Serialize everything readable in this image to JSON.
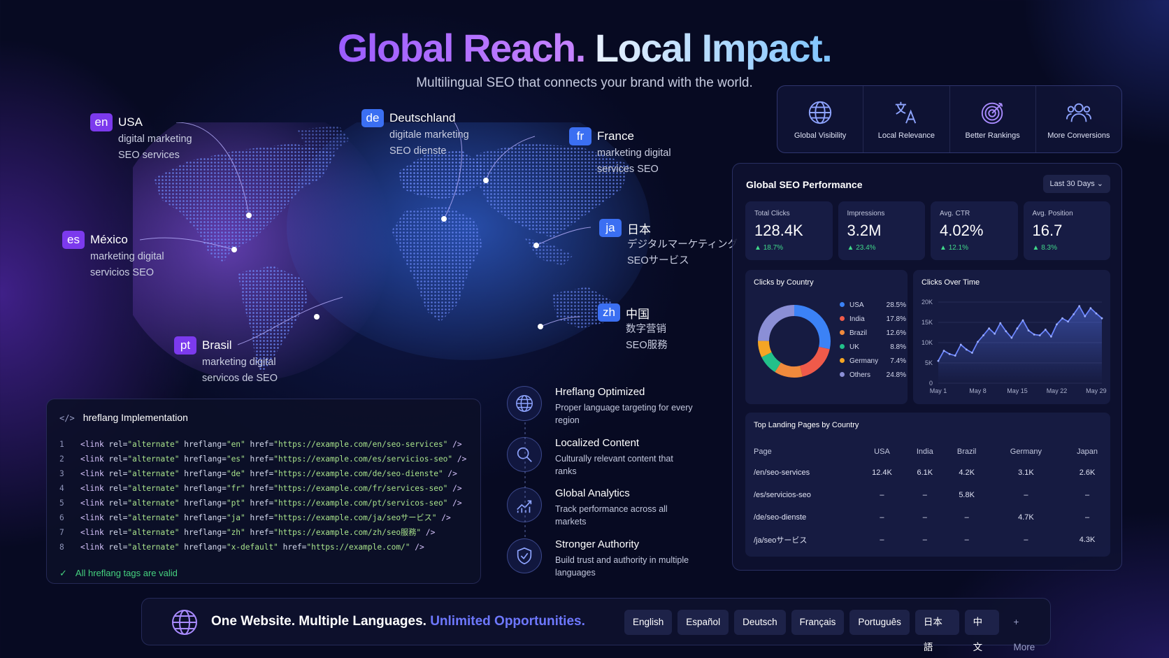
{
  "header": {
    "title_part1": "Global Reach.",
    "title_part2": "Local Impact.",
    "subtitle": "Multilingual SEO that connects your brand with the world."
  },
  "locations": [
    {
      "code": "en",
      "name": "USA",
      "keywords": [
        "digital marketing",
        "SEO services"
      ]
    },
    {
      "code": "de",
      "name": "Deutschland",
      "keywords": [
        "digitale marketing",
        "SEO dienste"
      ]
    },
    {
      "code": "fr",
      "name": "France",
      "keywords": [
        "marketing digital",
        "services SEO"
      ]
    },
    {
      "code": "es",
      "name": "México",
      "keywords": [
        "marketing digital",
        "servicios SEO"
      ]
    },
    {
      "code": "ja",
      "name": "日本",
      "keywords": [
        "デジタルマーケティング",
        "SEOサービス"
      ]
    },
    {
      "code": "zh",
      "name": "中国",
      "keywords": [
        "数字营销",
        "SEO服務"
      ]
    },
    {
      "code": "pt",
      "name": "Brasil",
      "keywords": [
        "marketing digital",
        "servicos de SEO"
      ]
    }
  ],
  "features": [
    {
      "label": "Global Visibility",
      "icon": "globe-icon"
    },
    {
      "label": "Local Relevance",
      "icon": "translate-icon"
    },
    {
      "label": "Better Rankings",
      "icon": "target-icon"
    },
    {
      "label": "More Conversions",
      "icon": "users-icon"
    }
  ],
  "dashboard": {
    "title": "Global SEO Performance",
    "range": "Last 30 Days",
    "kpis": [
      {
        "label": "Total Clicks",
        "value": "128.4K",
        "delta": "18.7%"
      },
      {
        "label": "Impressions",
        "value": "3.2M",
        "delta": "23.4%"
      },
      {
        "label": "Avg. CTR",
        "value": "4.02%",
        "delta": "12.1%"
      },
      {
        "label": "Avg. Position",
        "value": "16.7",
        "delta": "8.3%"
      }
    ],
    "country_title": "Clicks by Country",
    "time_title": "Clicks Over Time",
    "table_title": "Top Landing Pages by Country",
    "table": {
      "headers": [
        "Page",
        "USA",
        "India",
        "Brazil",
        "Germany",
        "Japan"
      ],
      "rows": [
        [
          "/en/seo-services",
          "12.4K",
          "6.1K",
          "4.2K",
          "3.1K",
          "2.6K"
        ],
        [
          "/es/servicios-seo",
          "–",
          "–",
          "5.8K",
          "–",
          "–"
        ],
        [
          "/de/seo-dienste",
          "–",
          "–",
          "–",
          "4.7K",
          "–"
        ],
        [
          "/ja/seoサービス",
          "–",
          "–",
          "–",
          "–",
          "4.3K"
        ]
      ]
    }
  },
  "chart_data": [
    {
      "type": "pie",
      "title": "Clicks by Country",
      "categories": [
        "USA",
        "India",
        "Brazil",
        "UK",
        "Germany",
        "Others"
      ],
      "values": [
        28.5,
        17.8,
        12.6,
        8.8,
        7.4,
        24.8
      ],
      "labels": [
        "28.5%",
        "17.8%",
        "12.6%",
        "8.8%",
        "7.4%",
        "24.8%"
      ],
      "colors": [
        "#3b82f6",
        "#ef5a4a",
        "#f08a3c",
        "#22c08a",
        "#f5a524",
        "#8b8fd6"
      ],
      "donut": true
    },
    {
      "type": "line",
      "title": "Clicks Over Time",
      "x_ticks": [
        "May 1",
        "May 8",
        "May 15",
        "May 22",
        "May 29"
      ],
      "y_ticks": [
        "20K",
        "15K",
        "10K",
        "5K",
        "0"
      ],
      "ylim": [
        0,
        20000
      ],
      "x": [
        1,
        2,
        3,
        4,
        5,
        6,
        7,
        8,
        9,
        10,
        11,
        12,
        13,
        14,
        15,
        16,
        17,
        18,
        19,
        20,
        21,
        22,
        23,
        24,
        25,
        26,
        27,
        28,
        29,
        30
      ],
      "values": [
        5500,
        8000,
        7200,
        6800,
        9500,
        8300,
        7500,
        10200,
        11800,
        13500,
        12200,
        14800,
        12800,
        11200,
        13500,
        15500,
        13000,
        12000,
        11800,
        13200,
        11500,
        14500,
        16000,
        15200,
        17000,
        19000,
        16500,
        18500,
        17200,
        16000
      ]
    }
  ],
  "hreflang": {
    "title": "hreflang Implementation",
    "icon": "code-icon",
    "lines": [
      {
        "n": "1",
        "tag": "<link",
        "rel": " rel=",
        "relv": "\"alternate\"",
        "hl": " hreflang=",
        "hlv": "\"en\"",
        "hr": " href=",
        "hrv": "\"https://example.com/en/seo-services\"",
        "end": " />"
      },
      {
        "n": "2",
        "tag": "<link",
        "rel": " rel=",
        "relv": "\"alternate\"",
        "hl": " hreflang=",
        "hlv": "\"es\"",
        "hr": " href=",
        "hrv": "\"https://example.com/es/servicios-seo\"",
        "end": " />"
      },
      {
        "n": "3",
        "tag": "<link",
        "rel": " rel=",
        "relv": "\"alternate\"",
        "hl": " hreflang=",
        "hlv": "\"de\"",
        "hr": " href=",
        "hrv": "\"https://example.com/de/seo-dienste\"",
        "end": " />"
      },
      {
        "n": "4",
        "tag": "<link",
        "rel": " rel=",
        "relv": "\"alternate\"",
        "hl": " hreflang=",
        "hlv": "\"fr\"",
        "hr": " href=",
        "hrv": "\"https://example.com/fr/services-seo\"",
        "end": " />"
      },
      {
        "n": "5",
        "tag": "<link",
        "rel": " rel=",
        "relv": "\"alternate\"",
        "hl": " hreflang=",
        "hlv": "\"pt\"",
        "hr": " href=",
        "hrv": "\"https://example.com/pt/servicos-seo\"",
        "end": " />"
      },
      {
        "n": "6",
        "tag": "<link",
        "rel": " rel=",
        "relv": "\"alternate\"",
        "hl": " hreflang=",
        "hlv": "\"ja\"",
        "hr": " href=",
        "hrv": "\"https://example.com/ja/seoサービス\"",
        "end": " />"
      },
      {
        "n": "7",
        "tag": "<link",
        "rel": " rel=",
        "relv": "\"alternate\"",
        "hl": " hreflang=",
        "hlv": "\"zh\"",
        "hr": " href=",
        "hrv": "\"https://example.com/zh/seo服務\"",
        "end": " />"
      },
      {
        "n": "8",
        "tag": "<link",
        "rel": " rel=",
        "relv": "\"alternate\"",
        "hl": " hreflang=",
        "hlv": "\"x-default\"",
        "hr": " href=",
        "hrv": "\"https://example.com/\"",
        "end": " />"
      }
    ],
    "valid_text": "All hreflang tags are valid"
  },
  "benefits": [
    {
      "title": "Hreflang Optimized",
      "desc": "Proper language targeting for every region",
      "icon": "globe-icon"
    },
    {
      "title": "Localized Content",
      "desc": "Culturally relevant content that ranks",
      "icon": "search-icon"
    },
    {
      "title": "Global Analytics",
      "desc": "Track performance across all markets",
      "icon": "analytics-icon"
    },
    {
      "title": "Stronger Authority",
      "desc": "Build trust and authority in multiple languages",
      "icon": "shield-icon"
    }
  ],
  "bottom_bar": {
    "message": "One Website. Multiple Languages.",
    "highlight": "Unlimited Opportunities.",
    "languages": [
      "English",
      "Español",
      "Deutsch",
      "Français",
      "Português",
      "日本語",
      "中文"
    ],
    "more": "+ More"
  },
  "colors": {
    "accent_purple": "#7c3aed",
    "accent_blue": "#3b6ff2",
    "positive": "#40d98a"
  }
}
